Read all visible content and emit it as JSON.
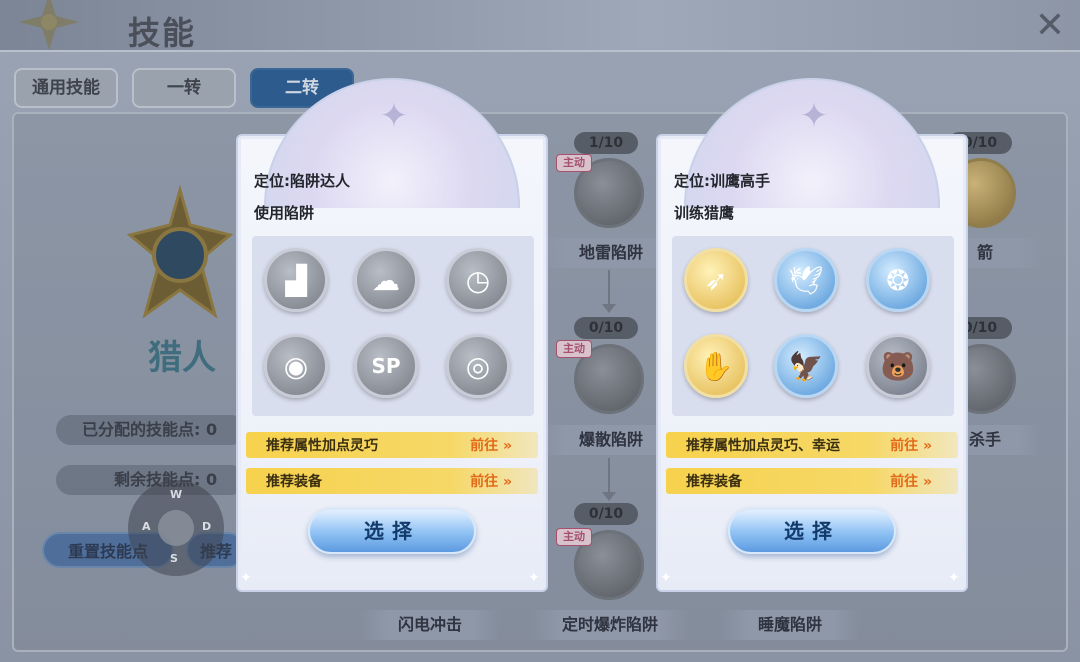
{
  "header": {
    "title": "技能",
    "close_label": "✕"
  },
  "tabs": [
    {
      "label": "通用技能",
      "active": false
    },
    {
      "label": "一转",
      "active": false
    },
    {
      "label": "二转",
      "active": true
    }
  ],
  "class_panel": {
    "class_name": "猎人",
    "allocated_points_label": "已分配的技能点: 0",
    "remaining_points_label": "剩余技能点: 0",
    "reset_button": "重置技能点",
    "second_button": "推荐"
  },
  "joystick": {
    "up": "W",
    "left": "A",
    "right": "D",
    "down": "S"
  },
  "background_tree": {
    "active_tag": "主动",
    "nodes": [
      {
        "level": "1/10",
        "label": "地雷陷阱"
      },
      {
        "level": "0/10",
        "label": "爆散陷阱"
      },
      {
        "level": "0/10",
        "label": "定时爆炸陷阱"
      },
      {
        "level": "0/10",
        "label": "箭"
      },
      {
        "level": "0/10",
        "label": "杀手"
      },
      {
        "label": "闪电冲击"
      },
      {
        "label": "睡魔陷阱"
      }
    ]
  },
  "cards": [
    {
      "role": "定位:陷阱达人",
      "subtitle": "使用陷阱",
      "icons": [
        "trap-base-icon",
        "cloud-trap-icon",
        "timer-trap-icon",
        "cat-trap-icon",
        "sp-icon",
        "target-trap-icon"
      ],
      "icon_styles": [
        "grey",
        "grey",
        "grey",
        "grey",
        "grey",
        "grey"
      ],
      "icon_glyphs": [
        "▟",
        "☁",
        "◷",
        "◉",
        "SP",
        "◎"
      ],
      "rec_attr_label": "推荐属性加点灵巧",
      "rec_equip_label": "推荐装备",
      "go_label": "前往 »",
      "choose_label": "选择"
    },
    {
      "role": "定位:训鹰高手",
      "subtitle": "训练猎鹰",
      "icons": [
        "arrow-burst-icon",
        "falcon-icon",
        "falcon-dive-icon",
        "claw-strike-icon",
        "falcon-wing-icon",
        "polar-bear-icon"
      ],
      "icon_styles": [
        "gold",
        "blue",
        "blue",
        "gold",
        "blue",
        "slate"
      ],
      "icon_glyphs": [
        "➶",
        "🕊",
        "❂",
        "✋",
        "🦅",
        "🐻"
      ],
      "rec_attr_label": "推荐属性加点灵巧、幸运",
      "rec_equip_label": "推荐装备",
      "go_label": "前往 »",
      "choose_label": "选择"
    }
  ]
}
